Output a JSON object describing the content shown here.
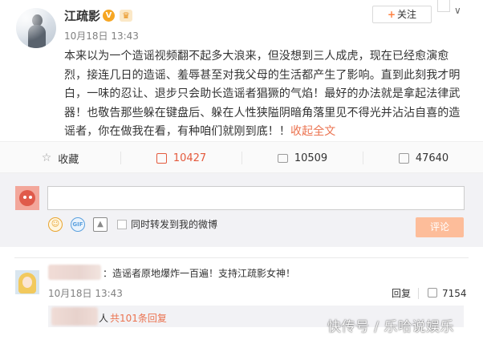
{
  "post": {
    "author": "江疏影",
    "verified_badge": "V",
    "member_badge": "crown-icon",
    "time": "10月18日 13:43",
    "follow_label": "+关注",
    "follow_plus": "+",
    "follow_text": "关注",
    "text": "本来以为一个造谣视频翻不起多大浪来，但没想到三人成虎，现在已经愈演愈烈，接连几日的造谣、羞辱甚至对我父母的生活都产生了影响。直到此刻我才明白，一味的忍让、退步只会助长造谣者猖獗的气焰！最好的办法就是拿起法律武器！也敬告那些躲在键盘后、躲在人性狭隘阴暗角落里见不得光并沾沾自喜的造谣者，你在做我在看，有种咱们就刚到底！！",
    "collapse_label": "收起全文"
  },
  "actions": {
    "favorite_label": "收藏",
    "repost_count": "10427",
    "comment_count": "10509",
    "like_count": "47640"
  },
  "composer": {
    "input_value": "",
    "repost_checkbox_label": "同时转发到我的微博",
    "submit_label": "评论"
  },
  "comment": {
    "text": "：造谣者原地爆炸一百遍！支持江疏影女神！",
    "time": "10月18日 13:43",
    "reply_label": "回复",
    "like_count": "7154",
    "reply_suffix": "人",
    "reply_count_label": "共101条回复"
  },
  "watermark": "快传号 / 乐哈说娱乐",
  "colors": {
    "accent_orange": "#eb7350",
    "repost_red": "#e45a3d",
    "submit_disabled": "#fdbd9a",
    "composer_bg": "#f2f2f5"
  }
}
